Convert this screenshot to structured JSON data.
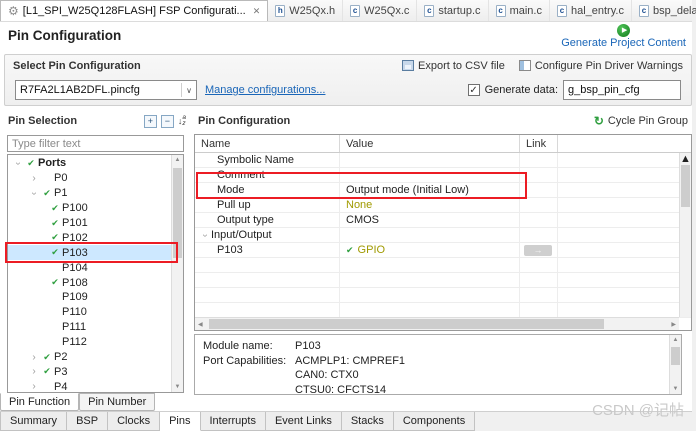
{
  "icons": {
    "gear": "⚙",
    "close": "✕",
    "h_file": "h",
    "c_file": "c",
    "play": "▶",
    "check": "✔",
    "checkbox": "✓",
    "combo_arrow": "∨",
    "chevron": "›",
    "cycle": "↻",
    "link_arrow": "→",
    "expand_all": "+",
    "collapse_all": "−",
    "sort_arrow": "↓",
    "sort_a": "a",
    "sort_z": "z",
    "scroll_up": "▲",
    "scroll_down": "▼",
    "scroll_left": "◀",
    "scroll_right": "▶"
  },
  "editor_tabs": [
    {
      "label": "[L1_SPI_W25Q128FLASH] FSP Configurati..."
    },
    {
      "label": "W25Qx.h"
    },
    {
      "label": "W25Qx.c"
    },
    {
      "label": "startup.c"
    },
    {
      "label": "main.c"
    },
    {
      "label": "hal_entry.c"
    },
    {
      "label": "bsp_delay.c"
    }
  ],
  "page_title": "Pin Configuration",
  "generate_project_content": "Generate Project Content",
  "select_pin_configuration": {
    "title": "Select Pin Configuration",
    "export_csv_button": "Export to CSV file",
    "configure_warnings_button": "Configure Pin Driver Warnings",
    "configuration_value": "R7FA2L1AB2DFL.pincfg",
    "manage_link": "Manage configurations...",
    "generate_data_label": "Generate data:",
    "generate_data_checked": true,
    "generate_data_value": "g_bsp_pin_cfg"
  },
  "pin_selection": {
    "title": "Pin Selection",
    "filter_placeholder": "Type filter text",
    "tree": [
      {
        "label": "Ports"
      },
      {
        "label": "P0"
      },
      {
        "label": "P1"
      },
      {
        "label": "P100"
      },
      {
        "label": "P101"
      },
      {
        "label": "P102"
      },
      {
        "label": "P103"
      },
      {
        "label": "P104"
      },
      {
        "label": "P108"
      },
      {
        "label": "P109"
      },
      {
        "label": "P110"
      },
      {
        "label": "P111"
      },
      {
        "label": "P112"
      },
      {
        "label": "P2"
      },
      {
        "label": "P3"
      },
      {
        "label": "P4"
      }
    ],
    "selected_item": "P103"
  },
  "pin_configuration": {
    "title": "Pin Configuration",
    "cycle_pin_group": "Cycle Pin Group",
    "columns": [
      "Name",
      "Value",
      "Link"
    ],
    "rows": [
      {
        "name": "Symbolic Name",
        "value": ""
      },
      {
        "name": "Comment",
        "value": ""
      },
      {
        "name": "Mode",
        "value": "Output mode (Initial Low)"
      },
      {
        "name": "Pull up",
        "value": "None"
      },
      {
        "name": "Output type",
        "value": "CMOS"
      },
      {
        "name": "Input/Output",
        "value": ""
      },
      {
        "name": "P103",
        "value": "GPIO"
      }
    ],
    "details": {
      "module_name_label": "Module name:",
      "module_name_value": "P103",
      "port_capabilities_label": "Port Capabilities:",
      "port_capabilities": [
        "ACMPLP1: CMPREF1",
        "CAN0: CTX0",
        "CTSU0: CFCTS14"
      ]
    }
  },
  "lower_tabs": [
    {
      "label": "Pin Function"
    },
    {
      "label": "Pin Number"
    }
  ],
  "bottom_tabs": [
    {
      "label": "Summary"
    },
    {
      "label": "BSP"
    },
    {
      "label": "Clocks"
    },
    {
      "label": "Pins"
    },
    {
      "label": "Interrupts"
    },
    {
      "label": "Event Links"
    },
    {
      "label": "Stacks"
    },
    {
      "label": "Components"
    }
  ],
  "active_bottom_tab": "Pins",
  "watermark": "CSDN @记帖",
  "colors": {
    "accent_red": "#ec1c24",
    "link_blue": "#1a66b8",
    "value_olive": "#a09a00",
    "check_green": "#2e9e3e",
    "selection_blue": "#cde8ff"
  }
}
